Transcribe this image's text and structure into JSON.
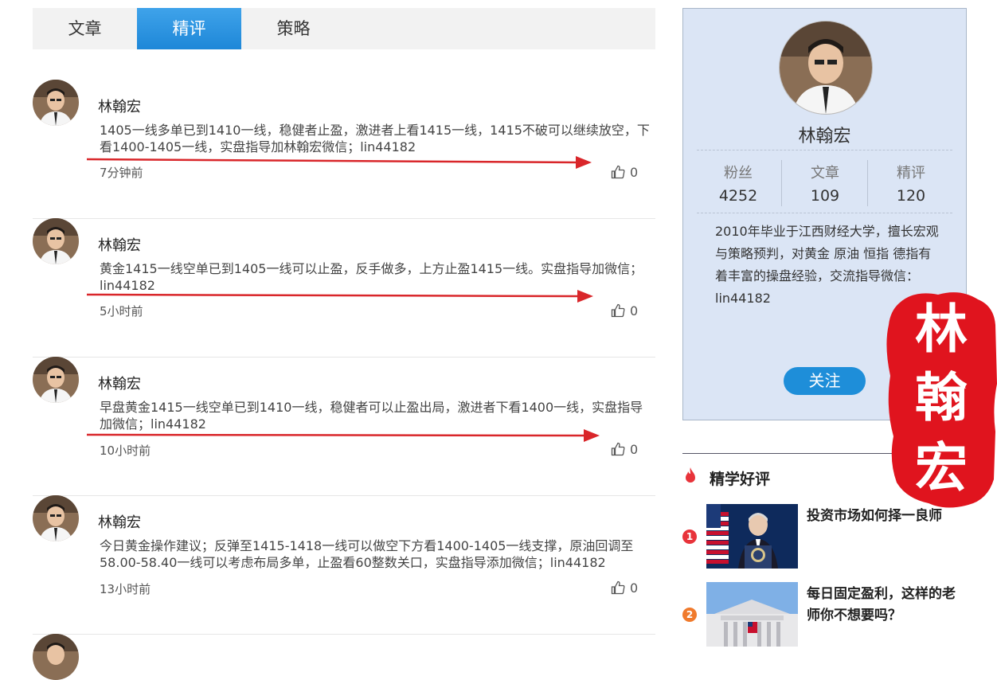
{
  "tabs": [
    {
      "label": "文章",
      "active": false
    },
    {
      "label": "精评",
      "active": true
    },
    {
      "label": "策略",
      "active": false
    }
  ],
  "posts": [
    {
      "author": "林翰宏",
      "text": "1405一线多单已到1410一线，稳健者止盈，激进者上看1415一线，1415不破可以继续放空，下看1400-1405一线，实盘指导加林翰宏微信；lin44182",
      "time": "7分钟前",
      "likes": "0"
    },
    {
      "author": "林翰宏",
      "text": "黄金1415一线空单已到1405一线可以止盈，反手做多，上方止盈1415一线。实盘指导加微信；lin44182",
      "time": "5小时前",
      "likes": "0"
    },
    {
      "author": "林翰宏",
      "text": "早盘黄金1415一线空单已到1410一线，稳健者可以止盈出局，激进者下看1400一线，实盘指导加微信；lin44182",
      "time": "10小时前",
      "likes": "0"
    },
    {
      "author": "林翰宏",
      "text": "今日黄金操作建议；反弹至1415-1418一线可以做空下方看1400-1405一线支撑，原油回调至58.00-58.40一线可以考虑布局多单，止盈看60整数关口，实盘指导添加微信；lin44182",
      "time": "13小时前",
      "likes": "0"
    }
  ],
  "profile": {
    "name": "林翰宏",
    "stats": [
      {
        "label": "粉丝",
        "value": "4252"
      },
      {
        "label": "文章",
        "value": "109"
      },
      {
        "label": "精评",
        "value": "120"
      }
    ],
    "bio": "2010年毕业于江西财经大学，擅长宏观与策略预判，对黄金 原油 恒指 德指有着丰富的操盘经验，交流指导微信：lin44182",
    "follow_label": "关注"
  },
  "hot": {
    "title": "精学好评",
    "items": [
      {
        "rank": "1",
        "title": "投资市场如何择一良师",
        "rank_color": "#e8333a"
      },
      {
        "rank": "2",
        "title": "每日固定盈利，这样的老师你不想要吗？",
        "rank_color": "#f07a2c"
      }
    ]
  },
  "seal_text": "林翰宏",
  "colors": {
    "accent": "#1e8ed9",
    "arrow": "#d9262a",
    "seal": "#e0141e",
    "card_bg": "#dbe5f5"
  },
  "icons": [
    "thumbs-up-icon",
    "flame-icon"
  ]
}
